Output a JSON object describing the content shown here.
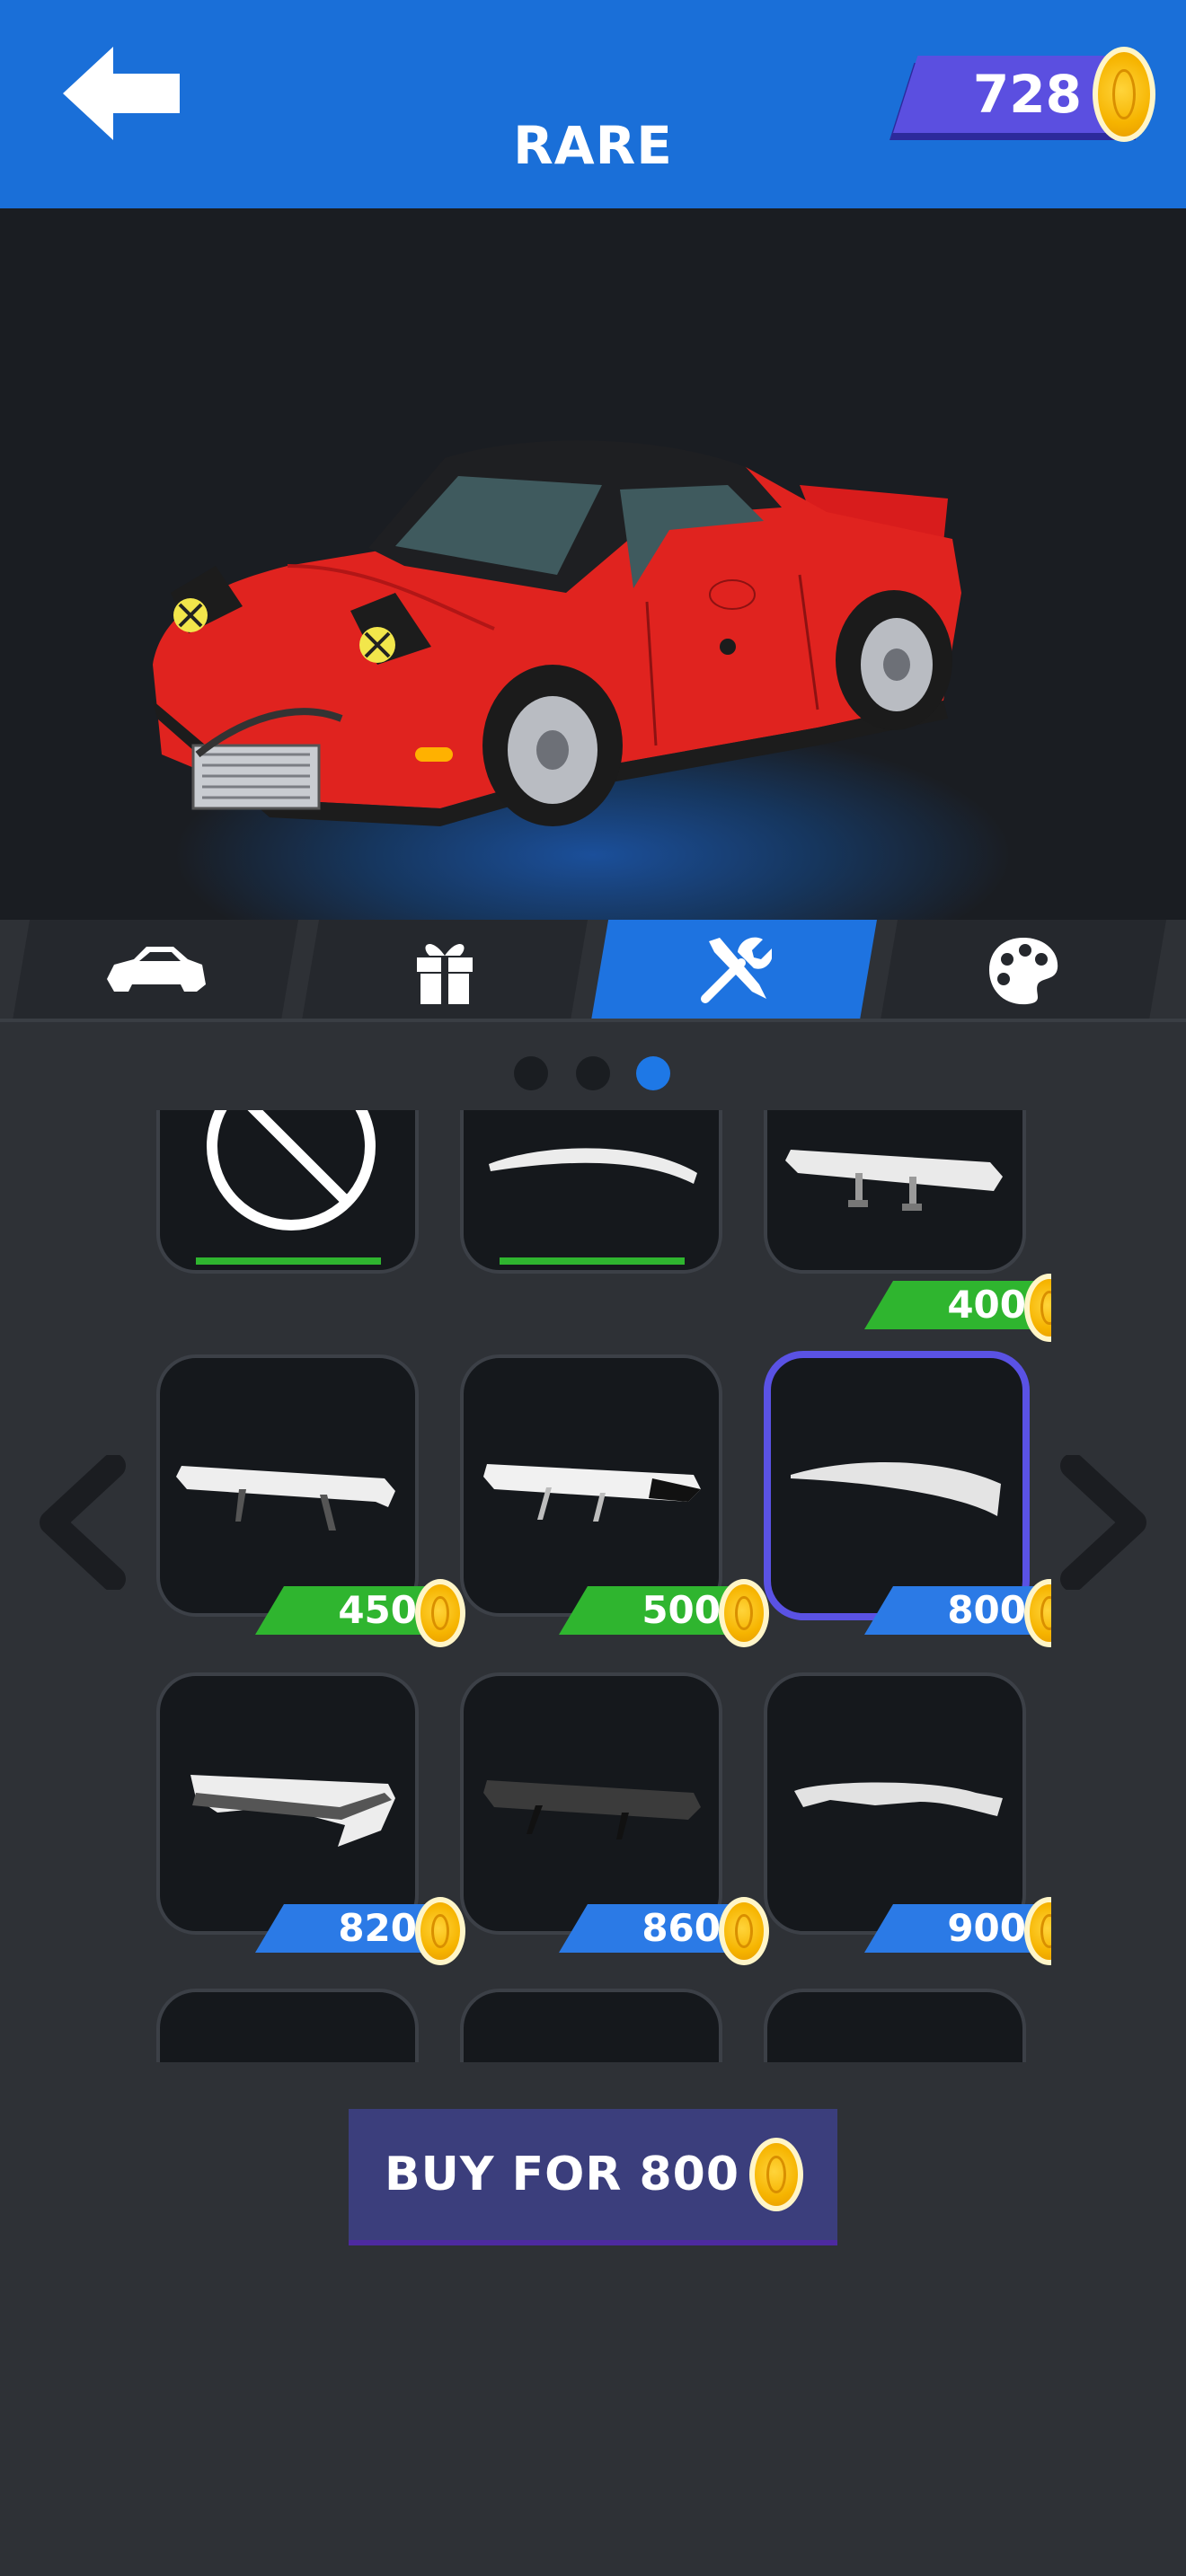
{
  "header": {
    "title": "RARE",
    "coins": "728",
    "back_icon": "back-arrow-icon"
  },
  "tabs": [
    {
      "name": "car",
      "icon": "car-icon",
      "active": false
    },
    {
      "name": "gift",
      "icon": "gift-icon",
      "active": false
    },
    {
      "name": "tools",
      "icon": "tools-icon",
      "active": true
    },
    {
      "name": "paint",
      "icon": "palette-icon",
      "active": false
    }
  ],
  "pager": {
    "pages": 3,
    "active_page": 3
  },
  "items": [
    {
      "row": 0,
      "col": 0,
      "kind": "none",
      "owned": true,
      "price": ""
    },
    {
      "row": 0,
      "col": 1,
      "kind": "lip",
      "owned": true,
      "price": ""
    },
    {
      "row": 0,
      "col": 2,
      "kind": "wing",
      "owned": false,
      "price": "400",
      "price_color": "green"
    },
    {
      "row": 1,
      "col": 0,
      "kind": "wing",
      "owned": false,
      "price": "450",
      "price_color": "green"
    },
    {
      "row": 1,
      "col": 1,
      "kind": "wing-dark",
      "owned": false,
      "price": "500",
      "price_color": "green"
    },
    {
      "row": 1,
      "col": 2,
      "kind": "ducktail",
      "owned": false,
      "price": "800",
      "price_color": "blue",
      "selected": true
    },
    {
      "row": 2,
      "col": 0,
      "kind": "double-wing",
      "owned": false,
      "price": "820",
      "price_color": "blue"
    },
    {
      "row": 2,
      "col": 1,
      "kind": "wing-dark",
      "owned": false,
      "price": "860",
      "price_color": "blue"
    },
    {
      "row": 2,
      "col": 2,
      "kind": "ducktail",
      "owned": false,
      "price": "900",
      "price_color": "blue"
    }
  ],
  "buy_button": {
    "label": "BUY FOR 800"
  },
  "colors": {
    "header": "#1a6fd8",
    "accent": "#5a52e4",
    "owned_green": "#2fb52f",
    "price_blue": "#2b7ae6"
  }
}
